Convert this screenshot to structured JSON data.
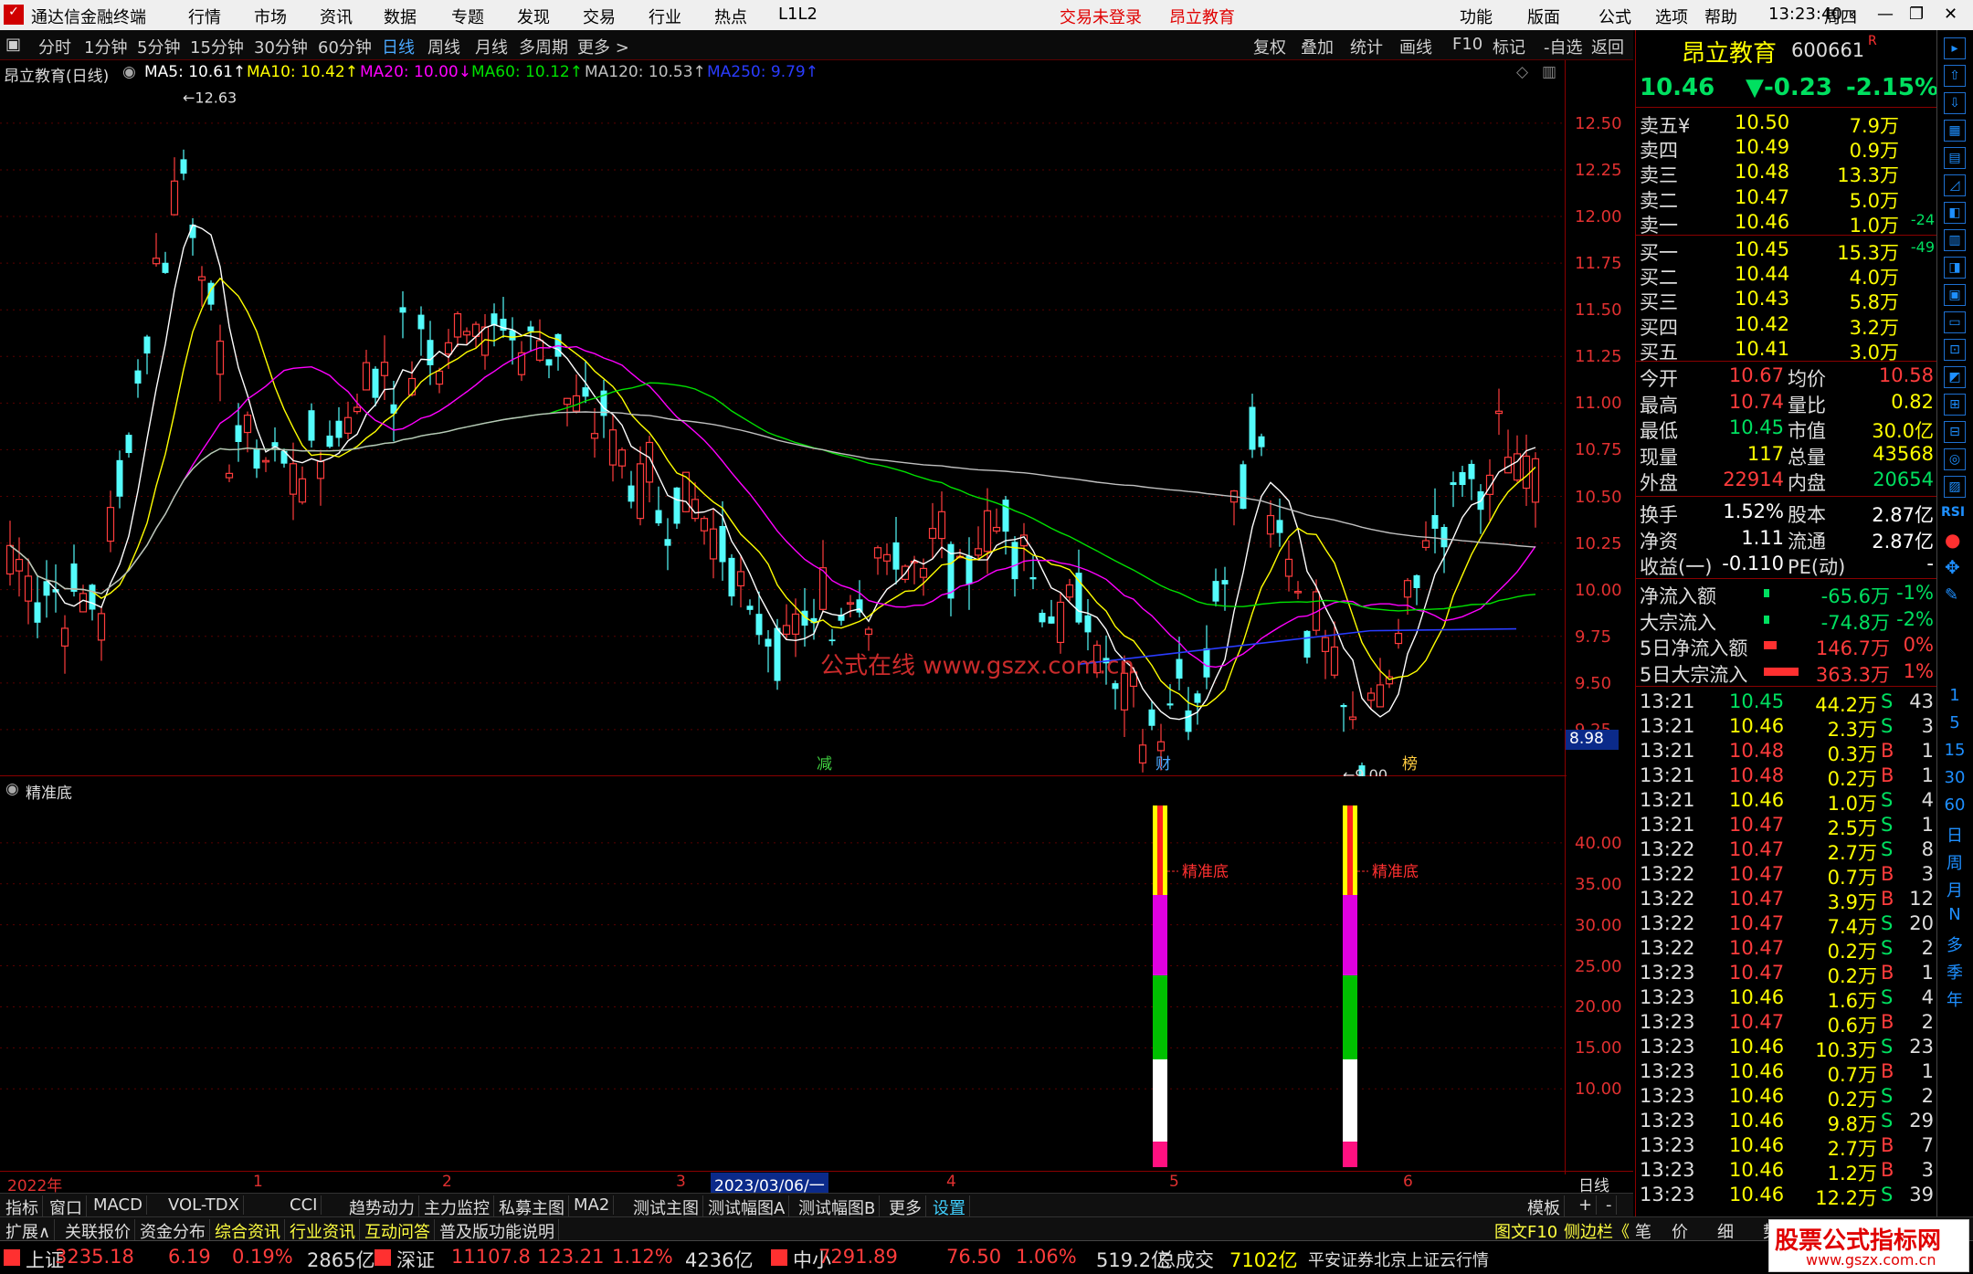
{
  "app_title": "通达信金融终端",
  "menus": [
    "行情",
    "市场",
    "资讯",
    "数据",
    "专题",
    "发现",
    "交易",
    "行业",
    "热点",
    "L1L2"
  ],
  "title_center": [
    "交易未登录",
    "昂立教育"
  ],
  "title_right": [
    "功能",
    "版面",
    "公式",
    "选项",
    "帮助",
    "13:23:40",
    "周四"
  ],
  "periods": [
    "分时",
    "1分钟",
    "5分钟",
    "15分钟",
    "30分钟",
    "60分钟",
    "日线",
    "周线",
    "月线",
    "多周期",
    "更多 >"
  ],
  "active_period": "日线",
  "toolbar_right": [
    "复权",
    "叠加",
    "统计",
    "画线",
    "F10",
    "标记",
    "-自选",
    "返回"
  ],
  "stock": {
    "name": "昂立教育",
    "code": "600661",
    "flag": "R",
    "price": "10.46",
    "change": "▼-0.23",
    "pct": "-2.15%"
  },
  "ma_line": {
    "title": "昂立教育(日线)",
    "items": [
      {
        "label": "MA5: 10.61↑",
        "color": "#ffffff"
      },
      {
        "label": "MA10: 10.42↑",
        "color": "#ffff00"
      },
      {
        "label": "MA20: 10.00↓",
        "color": "#ff00ff"
      },
      {
        "label": "MA60: 10.12↑",
        "color": "#00e000"
      },
      {
        "label": "MA120: 10.53↑",
        "color": "#c0c0c0"
      },
      {
        "label": "MA250: 9.79↑",
        "color": "#2a3cff"
      }
    ]
  },
  "price_axis": [
    "12.50",
    "12.25",
    "12.00",
    "11.75",
    "11.50",
    "11.25",
    "11.00",
    "10.75",
    "10.50",
    "10.25",
    "10.00",
    "9.75",
    "9.50",
    "9.25"
  ],
  "axis_box": "8.98",
  "chart_data": {
    "type": "candlestick",
    "ylim": [
      9.0,
      12.7
    ],
    "high_label": "12.63",
    "low_label": "9.00",
    "annotations": [
      "减",
      "财",
      "榜"
    ],
    "watermark": "公式在线 www.gszx.com.cn"
  },
  "sub": {
    "title": "精准底",
    "axis": [
      "40.00",
      "35.00",
      "30.00",
      "25.00",
      "20.00",
      "15.00",
      "10.00"
    ],
    "label": "精准底"
  },
  "dates": [
    "2022年",
    "1",
    "2",
    "2023/03/06/一",
    "3",
    "4",
    "5",
    "6",
    "日线"
  ],
  "tabs": [
    "指标",
    "窗口",
    "MACD",
    "VOL-TDX",
    "CCI",
    "趋势动力",
    "主力监控",
    "私募主图",
    "MA2",
    "测试主图",
    "测试幅图A",
    "测试幅图B",
    "更多",
    "设置",
    "模板",
    "+",
    "-"
  ],
  "tabs2": [
    "扩展∧",
    "关联报价",
    "资金分布",
    "综合资讯",
    "行业资讯",
    "互动问答",
    "普及版功能说明"
  ],
  "tabs2_right": [
    "图文F10",
    "侧边栏《",
    "笔",
    "价",
    "细",
    "势"
  ],
  "orderbook": {
    "sell": [
      [
        "卖五¥",
        "10.50",
        "7.9万",
        ""
      ],
      [
        "卖四",
        "10.49",
        "0.9万",
        ""
      ],
      [
        "卖三",
        "10.48",
        "13.3万",
        ""
      ],
      [
        "卖二",
        "10.47",
        "5.0万",
        ""
      ],
      [
        "卖一",
        "10.46",
        "1.0万",
        "-24"
      ]
    ],
    "buy": [
      [
        "买一",
        "10.45",
        "15.3万",
        "-49"
      ],
      [
        "买二",
        "10.44",
        "4.0万",
        ""
      ],
      [
        "买三",
        "10.43",
        "5.8万",
        ""
      ],
      [
        "买四",
        "10.42",
        "3.2万",
        ""
      ],
      [
        "买五",
        "10.41",
        "3.0万",
        ""
      ]
    ]
  },
  "stats": [
    [
      "今开",
      "10.67",
      "均价",
      "10.58"
    ],
    [
      "最高",
      "10.74",
      "量比",
      "0.82"
    ],
    [
      "最低",
      "10.45",
      "市值",
      "30.0亿"
    ],
    [
      "现量",
      "117",
      "总量",
      "43568"
    ],
    [
      "外盘",
      "22914",
      "内盘",
      "20654"
    ]
  ],
  "stats2": [
    [
      "换手",
      "1.52%",
      "股本",
      "2.87亿"
    ],
    [
      "净资",
      "1.11",
      "流通",
      "2.87亿"
    ],
    [
      "收益(一)",
      "-0.110",
      "PE(动)",
      "-"
    ]
  ],
  "flows": [
    [
      "净流入额",
      "-65.6万",
      "-1%"
    ],
    [
      "大宗流入",
      "-74.8万",
      "-2%"
    ],
    [
      "5日净流入额",
      "146.7万",
      "0%"
    ],
    [
      "5日大宗流入",
      "363.3万",
      "1%"
    ]
  ],
  "ticks": [
    [
      "13:21",
      "10.45",
      "44.2万",
      "S",
      "43"
    ],
    [
      "13:21",
      "10.46",
      "2.3万",
      "S",
      "3"
    ],
    [
      "13:21",
      "10.48",
      "0.3万",
      "B",
      "1"
    ],
    [
      "13:21",
      "10.48",
      "0.2万",
      "B",
      "1"
    ],
    [
      "13:21",
      "10.46",
      "1.0万",
      "S",
      "4"
    ],
    [
      "13:21",
      "10.47",
      "2.5万",
      "S",
      "1"
    ],
    [
      "13:22",
      "10.47",
      "2.7万",
      "S",
      "8"
    ],
    [
      "13:22",
      "10.47",
      "0.7万",
      "B",
      "3"
    ],
    [
      "13:22",
      "10.47",
      "3.9万",
      "B",
      "12"
    ],
    [
      "13:22",
      "10.47",
      "7.4万",
      "S",
      "20"
    ],
    [
      "13:22",
      "10.47",
      "0.2万",
      "S",
      "2"
    ],
    [
      "13:23",
      "10.47",
      "0.2万",
      "B",
      "1"
    ],
    [
      "13:23",
      "10.46",
      "1.6万",
      "S",
      "4"
    ],
    [
      "13:23",
      "10.47",
      "0.6万",
      "B",
      "2"
    ],
    [
      "13:23",
      "10.46",
      "10.3万",
      "S",
      "23"
    ],
    [
      "13:23",
      "10.46",
      "0.7万",
      "B",
      "1"
    ],
    [
      "13:23",
      "10.46",
      "0.2万",
      "S",
      "2"
    ],
    [
      "13:23",
      "10.46",
      "9.8万",
      "S",
      "29"
    ],
    [
      "13:23",
      "10.46",
      "2.7万",
      "B",
      "7"
    ],
    [
      "13:23",
      "10.46",
      "1.2万",
      "B",
      "3"
    ],
    [
      "13:23",
      "10.46",
      "12.2万",
      "S",
      "39"
    ]
  ],
  "side": [
    "1",
    "5",
    "15",
    "30",
    "60",
    "日",
    "周",
    "月",
    "N",
    "多",
    "季",
    "年"
  ],
  "status": [
    {
      "n": "上证",
      "v": "3235.18",
      "c": "6.19",
      "p": "0.19%",
      "a": "2865亿"
    },
    {
      "n": "深证",
      "v": "11107.8",
      "c": "123.21",
      "p": "1.12%",
      "a": "4236亿"
    },
    {
      "n": "中小",
      "v": "7291.89",
      "c": "76.50",
      "p": "1.06%",
      "a": "519.2亿"
    }
  ],
  "total_label": "总成交",
  "total": "7102亿",
  "broker": "平安证券北京上证云行情",
  "corner_logo": "股票公式指标网",
  "corner_url": "www.gszx.com.cn"
}
